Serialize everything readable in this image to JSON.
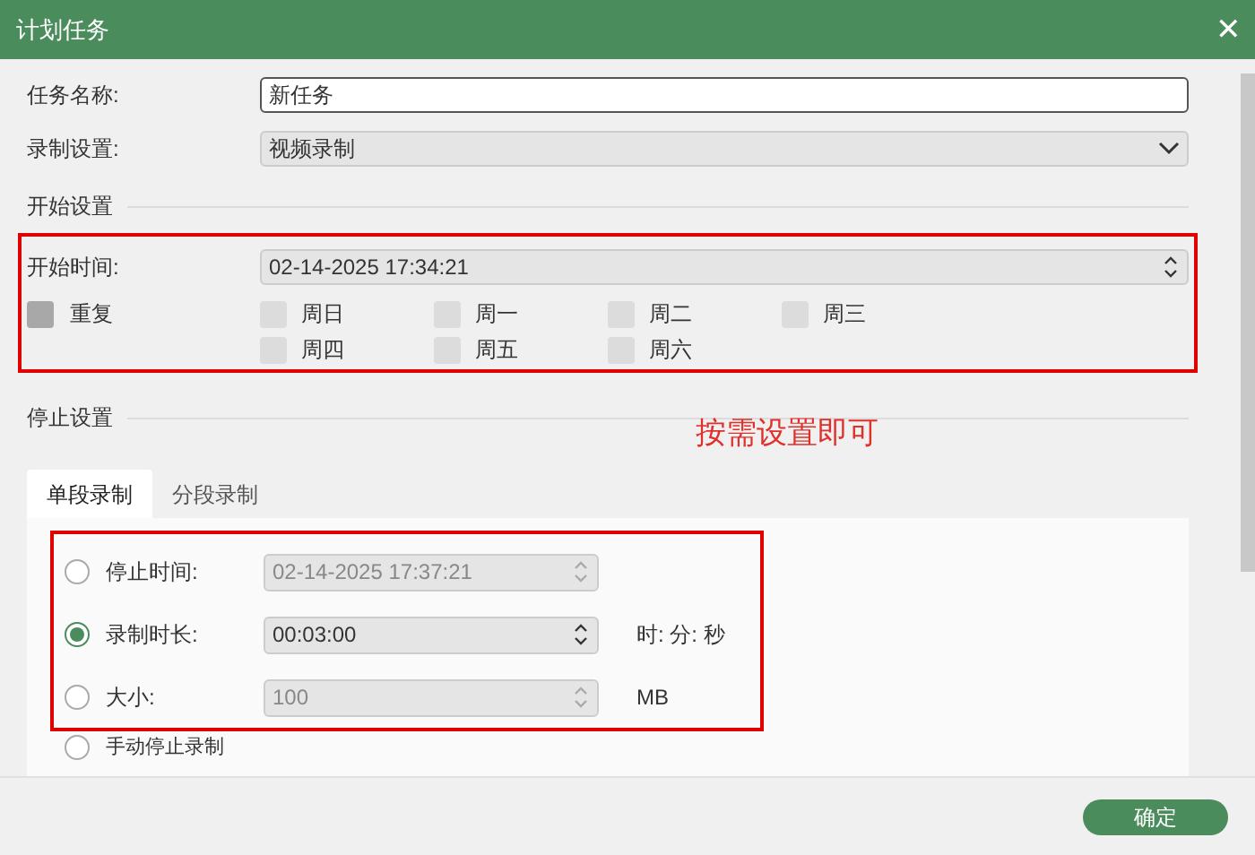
{
  "window": {
    "title": "计划任务",
    "close": "✕"
  },
  "task_name": {
    "label": "任务名称:",
    "value": "新任务"
  },
  "record_setting": {
    "label": "录制设置:",
    "value": "视频录制"
  },
  "start_section": {
    "title": "开始设置",
    "time_label": "开始时间:",
    "time_value": "02-14-2025 17:34:21",
    "repeat": {
      "label": "重复",
      "checked": false
    },
    "days": [
      {
        "label": "周日",
        "checked": false
      },
      {
        "label": "周一",
        "checked": false
      },
      {
        "label": "周二",
        "checked": false
      },
      {
        "label": "周三",
        "checked": false
      },
      {
        "label": "周四",
        "checked": false
      },
      {
        "label": "周五",
        "checked": false
      },
      {
        "label": "周六",
        "checked": false
      }
    ]
  },
  "stop_section": {
    "title": "停止设置",
    "tabs": [
      {
        "label": "单段录制",
        "selected": true
      },
      {
        "label": "分段录制",
        "selected": false
      }
    ],
    "options": [
      {
        "label": "停止时间:",
        "selected": false,
        "kind": "field",
        "value": "02-14-2025 17:37:21"
      },
      {
        "label": "录制时长:",
        "selected": true,
        "kind": "field",
        "value": "00:03:00",
        "unit": "时: 分: 秒"
      },
      {
        "label": "大小:",
        "selected": false,
        "kind": "field",
        "value": "100",
        "unit": "MB"
      },
      {
        "label": "手动停止录制",
        "selected": false,
        "kind": "plain"
      }
    ]
  },
  "annotation": "按需设置即可",
  "buttons": [
    "确定"
  ]
}
